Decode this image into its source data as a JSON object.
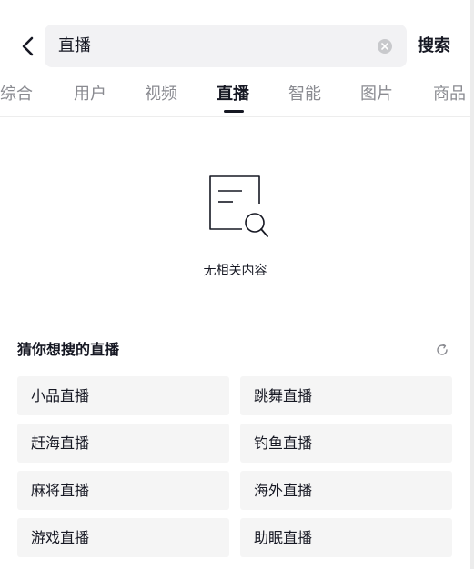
{
  "search": {
    "query": "直播",
    "submit_label": "搜索"
  },
  "tabs": [
    {
      "label": "综合"
    },
    {
      "label": "用户"
    },
    {
      "label": "视频"
    },
    {
      "label": "直播"
    },
    {
      "label": "智能"
    },
    {
      "label": "图片"
    },
    {
      "label": "商品"
    }
  ],
  "active_tab": "直播",
  "empty_state": {
    "text": "无相关内容",
    "icon": "document-search-icon"
  },
  "suggestions": {
    "title": "猜你想搜的直播",
    "refresh_icon": "refresh-icon",
    "items": [
      {
        "label": "小品直播"
      },
      {
        "label": "跳舞直播"
      },
      {
        "label": "赶海直播"
      },
      {
        "label": "钓鱼直播"
      },
      {
        "label": "麻将直播"
      },
      {
        "label": "海外直播"
      },
      {
        "label": "游戏直播"
      },
      {
        "label": "助眠直播"
      }
    ]
  },
  "icons": {
    "back": "chevron-left-icon",
    "clear": "clear-icon"
  },
  "colors": {
    "text_primary": "#161823",
    "text_secondary": "#8a8b91",
    "search_bg": "#f2f2f4",
    "chip_bg": "#f5f5f5"
  }
}
